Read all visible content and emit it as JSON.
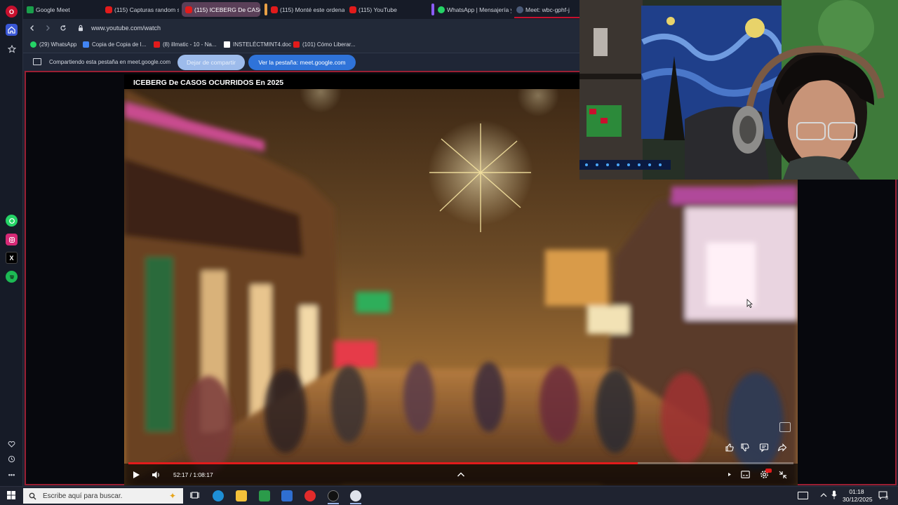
{
  "tabs": [
    {
      "label": "Google Meet",
      "icon": "google-meet-icon",
      "active": false
    },
    {
      "label": "(115) Capturas random sin",
      "icon": "youtube-icon",
      "active": false
    },
    {
      "label": "(115) ICEBERG De CASOS",
      "icon": "youtube-icon",
      "active": true
    },
    {
      "label": "(115) Monté este ordenad",
      "icon": "youtube-icon",
      "active": false
    },
    {
      "label": "(115) YouTube",
      "icon": "youtube-icon",
      "active": false
    },
    {
      "label": "WhatsApp | Mensajería y",
      "icon": "whatsapp-icon",
      "active": false
    },
    {
      "label": "Meet: wbc-gphf-j",
      "icon": "meet-icon",
      "active": false
    }
  ],
  "address": {
    "url": "www.youtube.com/watch"
  },
  "bookmarks": [
    {
      "label": "(29) WhatsApp",
      "icon": "whatsapp-icon"
    },
    {
      "label": "Copia de Copia de I...",
      "icon": "docs-icon"
    },
    {
      "label": "(8) illmatic - 10 - Na...",
      "icon": "youtube-icon"
    },
    {
      "label": "INSTELÉCTMINT4.doc",
      "icon": "document-icon"
    },
    {
      "label": "(101) Cómo Liberar...",
      "icon": "youtube-icon"
    }
  ],
  "share": {
    "status": "Compartiendo esta pestaña en meet.google.com",
    "stop_label": "Dejar de compartir",
    "view_label": "Ver la pestaña: meet.google.com"
  },
  "video": {
    "title": "ICEBERG De CASOS OCURRIDOS En 2025",
    "time": "52:17 / 1:08:17",
    "progress": 0.766
  },
  "taskbar": {
    "search_placeholder": "Escribe aquí para buscar.",
    "time": "01:18",
    "date": "30/12/2025",
    "notifications": "3"
  },
  "colors": {
    "accent": "#e21b1b",
    "frame_border": "#9a1f33",
    "active_tab": "#5a3f58",
    "share_button": "#2f73d9"
  }
}
